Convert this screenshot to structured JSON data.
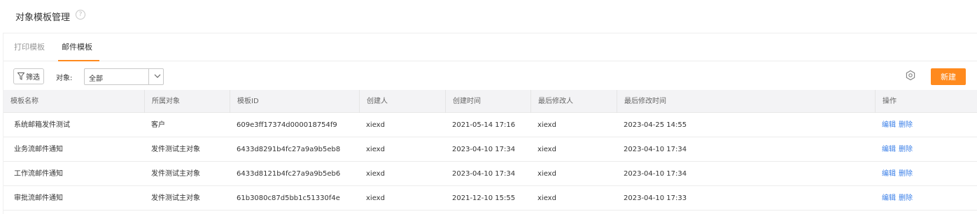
{
  "header": {
    "title": "对象模板管理",
    "help_glyph": "?"
  },
  "tabs": [
    {
      "label": "打印模板",
      "active": false
    },
    {
      "label": "邮件模板",
      "active": true
    }
  ],
  "toolbar": {
    "filter_label": "筛选",
    "object_label": "对象:",
    "object_select_value": "全部",
    "new_button_label": "新建"
  },
  "colors": {
    "accent": "#ff8a1e",
    "link": "#3a7fe8",
    "header_bg": "#f3f3f5"
  },
  "table": {
    "columns": [
      "模板名称",
      "所属对象",
      "模板ID",
      "创建人",
      "创建时间",
      "最后修改人",
      "最后修改时间",
      "操作"
    ],
    "rows": [
      {
        "name": "系统邮箱发件测试",
        "object": "客户",
        "id": "609e3ff17374d000018754f9",
        "creator": "xiexd",
        "created": "2021-05-14 17:16",
        "modifier": "xiexd",
        "modified": "2023-04-25 14:55",
        "edit": "编辑",
        "delete": "删除"
      },
      {
        "name": "业务流邮件通知",
        "object": "发件测试主对象",
        "id": "6433d8291b4fc27a9a9b5eb8",
        "creator": "xiexd",
        "created": "2023-04-10 17:34",
        "modifier": "xiexd",
        "modified": "2023-04-10 17:34",
        "edit": "编辑",
        "delete": "删除"
      },
      {
        "name": "工作流邮件通知",
        "object": "发件测试主对象",
        "id": "6433d8121b4fc27a9a9b5eb6",
        "creator": "xiexd",
        "created": "2023-04-10 17:34",
        "modifier": "xiexd",
        "modified": "2023-04-10 17:34",
        "edit": "编辑",
        "delete": "删除"
      },
      {
        "name": "审批流邮件通知",
        "object": "发件测试主对象",
        "id": "61b3080c87d5bb1c51330f4e",
        "creator": "xiexd",
        "created": "2021-12-10 15:55",
        "modifier": "xiexd",
        "modified": "2023-04-10 17:33",
        "edit": "编辑",
        "delete": "删除"
      }
    ]
  }
}
